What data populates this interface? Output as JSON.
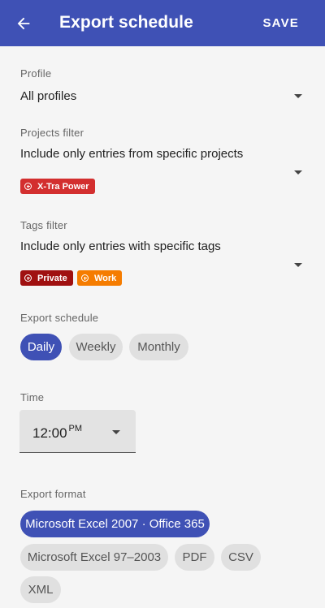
{
  "header": {
    "title": "Export schedule",
    "save_label": "SAVE",
    "colors": {
      "appbar": "#3f51b5"
    }
  },
  "profile": {
    "label": "Profile",
    "value": "All profiles"
  },
  "projects_filter": {
    "label": "Projects filter",
    "value": "Include only entries from specific projects",
    "tags": [
      {
        "label": "X-Tra Power",
        "color": "#d32f2f"
      }
    ]
  },
  "tags_filter": {
    "label": "Tags filter",
    "value": "Include only entries with specific tags",
    "tags": [
      {
        "label": "Private",
        "color": "#a01010"
      },
      {
        "label": "Work",
        "color": "#f57c00"
      }
    ]
  },
  "schedule": {
    "label": "Export schedule",
    "options": [
      "Daily",
      "Weekly",
      "Monthly"
    ],
    "selected": "Daily"
  },
  "time": {
    "label": "Time",
    "value": "12:00",
    "ampm": "PM"
  },
  "format": {
    "label": "Export format",
    "options": [
      "Microsoft Excel 2007 · Office 365",
      "Microsoft Excel 97–2003",
      "PDF",
      "CSV",
      "XML"
    ],
    "selected": "Microsoft Excel 2007 · Office 365"
  }
}
